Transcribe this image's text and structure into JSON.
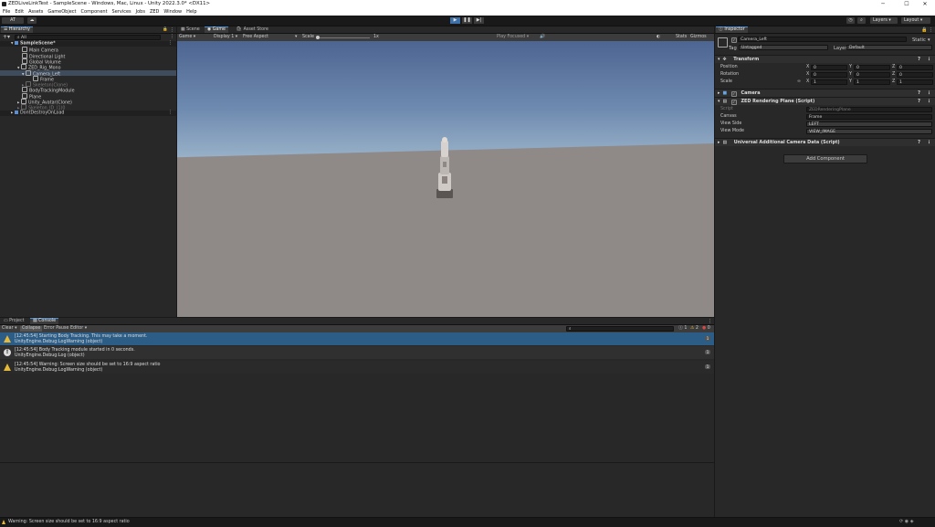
{
  "window": {
    "title": "ZEDLiveLinkTest - SampleScene - Windows, Mac, Linux - Unity 2022.3.0* <DX11>"
  },
  "menu": [
    "File",
    "Edit",
    "Assets",
    "GameObject",
    "Component",
    "Services",
    "Jobs",
    "ZED",
    "Window",
    "Help"
  ],
  "toolbar": {
    "account": "AT",
    "layers": "Layers",
    "layout": "Layout"
  },
  "hierarchy": {
    "tab": "Hierarchy",
    "search_placeholder": "All",
    "items": [
      {
        "label": "SampleScene*",
        "indent": 0
      },
      {
        "label": "Main Camera",
        "indent": 1
      },
      {
        "label": "Directional Light",
        "indent": 1
      },
      {
        "label": "Global Volume",
        "indent": 1
      },
      {
        "label": "ZED_Rig_Mono",
        "indent": 1
      },
      {
        "label": "Camera_Left",
        "indent": 2
      },
      {
        "label": "Frame",
        "indent": 3
      },
      {
        "label": "Skeleton(Clone)",
        "indent": 1
      },
      {
        "label": "BodyTrackingModule",
        "indent": 1
      },
      {
        "label": "Plane",
        "indent": 1
      },
      {
        "label": "Unity_Avatar(Clone)",
        "indent": 1
      },
      {
        "label": "Skeleton_ID_(1)0",
        "indent": 1
      },
      {
        "label": "DontDestroyOnLoad",
        "indent": 0
      }
    ]
  },
  "game": {
    "tabs": [
      "Scene",
      "Game",
      "Asset Store"
    ],
    "mode": "Game",
    "display": "Display 1",
    "aspect": "Free Aspect",
    "scale_label": "Scale",
    "scale_value": "1x",
    "play_focused": "Play Focused",
    "stats": "Stats",
    "gizmos": "Gizmos"
  },
  "inspector": {
    "tab": "Inspector",
    "object_name": "Camera_Left",
    "static_label": "Static",
    "tag_label": "Tag",
    "tag_value": "Untagged",
    "layer_label": "Layer",
    "layer_value": "Default",
    "transform": {
      "title": "Transform",
      "position_label": "Position",
      "rotation_label": "Rotation",
      "scale_label": "Scale",
      "position": [
        "0",
        "0",
        "0"
      ],
      "rotation": [
        "0",
        "0",
        "0"
      ],
      "scale": [
        "1",
        "1",
        "1"
      ]
    },
    "camera_title": "Camera",
    "zed_plane": {
      "title": "ZED Rendering Plane (Script)",
      "script_label": "Script",
      "script_value": "ZEDRenderingPlane",
      "canvas_label": "Canvas",
      "canvas_value": "Frame",
      "viewside_label": "View Side",
      "viewside_value": "LEFT",
      "viewmode_label": "View Mode",
      "viewmode_value": "VIEW_IMAGE"
    },
    "urp_title": "Universal Additional Camera Data (Script)",
    "add_component": "Add Component"
  },
  "console": {
    "tabs": [
      "Project",
      "Console"
    ],
    "buttons": [
      "Clear",
      "Collapse",
      "Error Pause",
      "Editor"
    ],
    "counts": {
      "info": "1",
      "warn": "2",
      "error": "0"
    },
    "logs": [
      {
        "type": "warning",
        "line1": "[12:45:54] Starting Body Tracking. This may take a moment.",
        "line2": "UnityEngine.Debug:LogWarning (object)",
        "count": "1"
      },
      {
        "type": "info",
        "line1": "[12:45:54] Body Tracking module started in 0 seconds.",
        "line2": "UnityEngine.Debug:Log (object)",
        "count": "1"
      },
      {
        "type": "warning",
        "line1": "[12:45:54] Warning: Screen size should be set to 16:9 aspect ratio",
        "line2": "UnityEngine.Debug:LogWarning (object)",
        "count": "1"
      }
    ]
  },
  "status": {
    "message": "Warning: Screen size should be set to 16:9 aspect ratio"
  },
  "colors": {
    "accent": "#4d90d6",
    "selection": "#2c5d87",
    "warning": "#e6b83a"
  }
}
